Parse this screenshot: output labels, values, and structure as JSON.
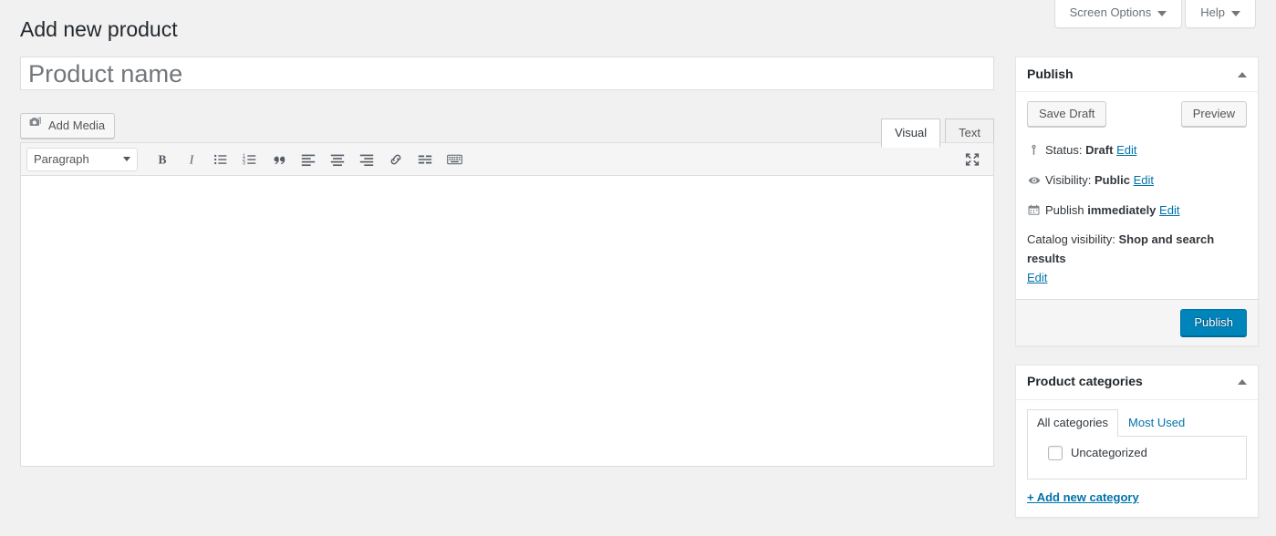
{
  "screen_meta": {
    "screen_options_label": "Screen Options",
    "help_label": "Help"
  },
  "page": {
    "title": "Add new product"
  },
  "title_field": {
    "value": "",
    "placeholder": "Product name"
  },
  "editor": {
    "add_media_label": "Add Media",
    "tabs": [
      {
        "label": "Visual",
        "active": true
      },
      {
        "label": "Text",
        "active": false
      }
    ],
    "format_select": "Paragraph",
    "toolbar_buttons": [
      "bold-icon",
      "italic-icon",
      "bulleted-list-icon",
      "numbered-list-icon",
      "blockquote-icon",
      "align-left-icon",
      "align-center-icon",
      "align-right-icon",
      "insert-link-icon",
      "insert-read-more-icon",
      "toolbar-toggle-icon"
    ],
    "fullscreen_icon": "distraction-free-icon",
    "content": ""
  },
  "publish_box": {
    "title": "Publish",
    "save_draft_label": "Save Draft",
    "preview_label": "Preview",
    "status_label": "Status:",
    "status_value": "Draft",
    "status_edit": "Edit",
    "visibility_label": "Visibility:",
    "visibility_value": "Public",
    "visibility_edit": "Edit",
    "publish_time_label": "Publish",
    "publish_time_value": "immediately",
    "publish_time_edit": "Edit",
    "catalog_visibility_label": "Catalog visibility:",
    "catalog_visibility_value": "Shop and search results",
    "catalog_visibility_edit": "Edit",
    "publish_button_label": "Publish"
  },
  "categories_box": {
    "title": "Product categories",
    "tabs": [
      {
        "label": "All categories",
        "active": true
      },
      {
        "label": "Most Used",
        "active": false
      }
    ],
    "items": [
      {
        "label": "Uncategorized",
        "checked": false
      }
    ],
    "add_new_label": "+ Add new category"
  },
  "colors": {
    "accent": "#0073aa",
    "primary_button": "#0085ba",
    "page_background": "#f1f1f1",
    "panel_background": "#ffffff",
    "border": "#e5e5e5"
  }
}
